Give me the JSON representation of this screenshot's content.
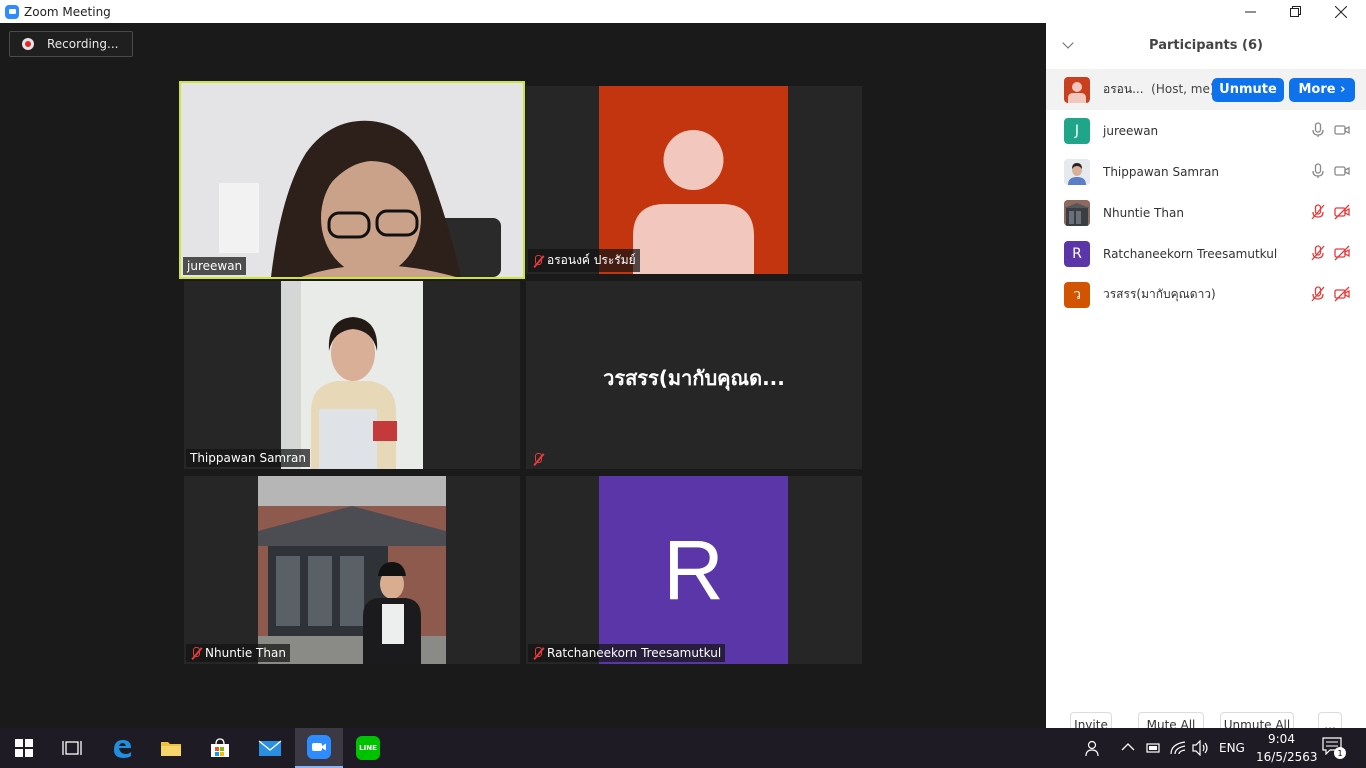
{
  "window": {
    "title": "Zoom Meeting"
  },
  "recording": {
    "label": "Recording..."
  },
  "tiles": [
    {
      "name": "jureewan",
      "muted": false,
      "active": true
    },
    {
      "name": "อรอนงค์ ประรัมย์",
      "muted": true
    },
    {
      "name": "Thippawan Samran",
      "muted": false
    },
    {
      "name": "",
      "display_name": "วรสรร(มากับคุณด...",
      "muted": true
    },
    {
      "name": "Nhuntie Than",
      "muted": true
    },
    {
      "name": "Ratchaneekorn Treesamutkul",
      "muted": true,
      "initial": "R"
    }
  ],
  "panel": {
    "title": "Participants (6)",
    "participants": [
      {
        "name": "อรอน...",
        "role": "(Host, me)",
        "avatar_color": "#c9401f",
        "initial": ""
      },
      {
        "name": "jureewan",
        "avatar_color": "#1fa58a",
        "initial": "J",
        "mic": "on",
        "video": "on"
      },
      {
        "name": "Thippawan Samran",
        "avatar_color": "#cfd7e6",
        "initial": "",
        "mic": "on",
        "video": "on"
      },
      {
        "name": "Nhuntie Than",
        "avatar_color": "#7a6f6a",
        "initial": "",
        "mic": "off",
        "video": "off"
      },
      {
        "name": "Ratchaneekorn Treesamutkul",
        "avatar_color": "#5b36a8",
        "initial": "R",
        "mic": "off",
        "video": "off"
      },
      {
        "name": "วรสรร(มากับคุณดาว)",
        "avatar_color": "#d35400",
        "initial": "ว",
        "mic": "off",
        "video": "off"
      }
    ],
    "unmute_label": "Unmute",
    "more_label": "More ›",
    "invite_label": "Invite",
    "mute_all_label": "Mute All",
    "unmute_all_label": "Unmute All",
    "ellipsis_label": "..."
  },
  "taskbar": {
    "lang": "ENG",
    "time": "9:04",
    "date": "16/5/2563",
    "notif_count": "1",
    "line_label": "LINE"
  },
  "colors": {
    "accent_blue": "#0e72ed",
    "active_border": "#cfe43a",
    "muted_red": "#e53b3b"
  }
}
